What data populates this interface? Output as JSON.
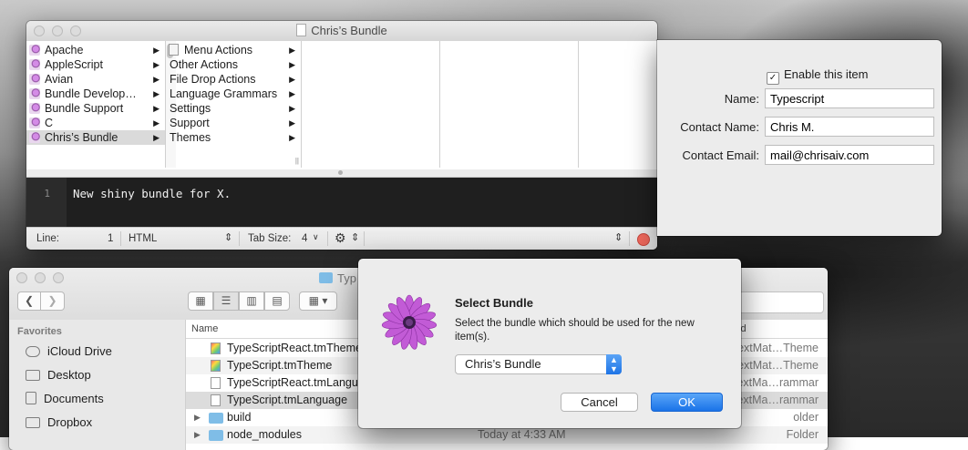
{
  "bundle_window": {
    "title": "Chris’s Bundle",
    "col1": [
      "Apache",
      "AppleScript",
      "Avian",
      "Bundle Develop…",
      "Bundle Support",
      "C",
      "Chris’s Bundle"
    ],
    "col2": [
      "Menu Actions",
      "Other Actions",
      "File Drop Actions",
      "Language Grammars",
      "Settings",
      "Support",
      "Themes"
    ],
    "editor_line": "1",
    "editor_text": "New shiny bundle for X.",
    "status": {
      "line_label": "Line:",
      "line_value": "1",
      "language": "HTML",
      "tab_size_label": "Tab Size:",
      "tab_size_value": "4"
    }
  },
  "properties": {
    "enable_label": "Enable this item",
    "name_label": "Name:",
    "name_value": "Typescript",
    "contact_name_label": "Contact Name:",
    "contact_name_value": "Chris M.",
    "contact_email_label": "Contact Email:",
    "contact_email_value": "mail@chrisaiv.com"
  },
  "finder": {
    "title_fragment": "Typ",
    "sidebar_heading": "Favorites",
    "sidebar_items": [
      "iCloud Drive",
      "Desktop",
      "Documents",
      "Dropbox"
    ],
    "column_name": "Name",
    "column_kind": "ind",
    "rows": [
      {
        "name": "TypeScriptReact.tmTheme",
        "kind": "extMat…Theme"
      },
      {
        "name": "TypeScript.tmTheme",
        "kind": "extMat…Theme"
      },
      {
        "name": "TypeScriptReact.tmLangua",
        "kind": "extMa…rammar"
      },
      {
        "name": "TypeScript.tmLanguage",
        "kind": "extMa…rammar"
      },
      {
        "name": "build",
        "kind": "older"
      },
      {
        "name": "node_modules",
        "date": "Today at 4:33 AM",
        "kind": "Folder"
      }
    ]
  },
  "dialog": {
    "title": "Select Bundle",
    "message": "Select the bundle which should be used for the new item(s).",
    "selected": "Chris’s Bundle",
    "cancel": "Cancel",
    "ok": "OK"
  },
  "colors": {
    "accent": "#1a73e8",
    "close": "#f26a5e",
    "editor_bg": "#1f1f1f"
  }
}
